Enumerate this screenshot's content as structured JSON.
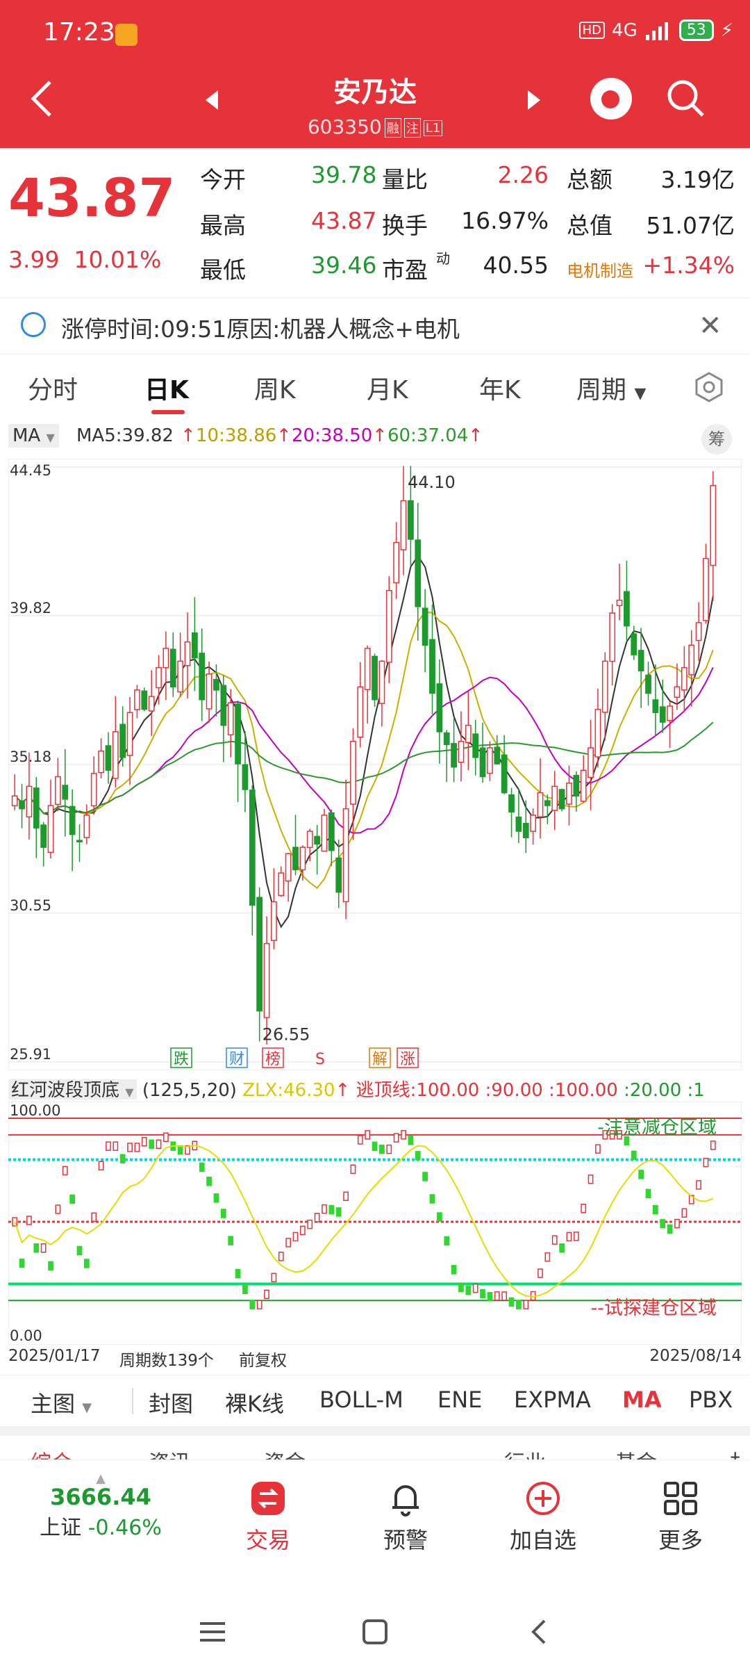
{
  "status": {
    "time": "17:23",
    "hd": "HD",
    "network": "4G",
    "battery": "53"
  },
  "header": {
    "title": "安乃达",
    "code": "603350",
    "tag1": "融",
    "tag2": "注",
    "tag3": "L1"
  },
  "quote": {
    "price": "43.87",
    "change": "3.99",
    "change_pct": "10.01%",
    "rows": [
      {
        "l1": "今开",
        "v1": "39.78",
        "l2": "量比",
        "v2": "2.26",
        "l3": "总额",
        "v3": "3.19亿"
      },
      {
        "l1": "最高",
        "v1": "43.87",
        "l2": "换手",
        "v2": "16.97%",
        "l3": "总值",
        "v3": "51.07亿"
      },
      {
        "l1": "最低",
        "v1": "39.46",
        "l2": "市盈",
        "l2sup": "动",
        "v2": "40.55",
        "l3": "电机制造",
        "v3": "+1.34%"
      }
    ]
  },
  "notice": {
    "text": "涨停时间:09:51原因:机器人概念+电机"
  },
  "tabs": [
    "分时",
    "日K",
    "周K",
    "月K",
    "年K",
    "周期"
  ],
  "ma": {
    "selector": "MA",
    "ma5": "MA5:39.82",
    "ma10": "10:38.86",
    "ma20": "20:38.50",
    "ma60": "60:37.04",
    "chip": "筹"
  },
  "chart_data": [
    {
      "type": "candlestick",
      "title": "安乃达 日K",
      "y_ticks": [
        "44.45",
        "39.82",
        "35.18",
        "30.55",
        "25.91"
      ],
      "ylim": [
        25.91,
        44.45
      ],
      "annotations": {
        "high": "44.10",
        "low": "26.55"
      },
      "event_markers": [
        "跌",
        "财",
        "榜",
        "S",
        "解",
        "涨"
      ],
      "series": [
        {
          "name": "MA5",
          "color": "#333333"
        },
        {
          "name": "MA10",
          "color": "#c9b000"
        },
        {
          "name": "MA20",
          "color": "#c000c0"
        },
        {
          "name": "MA60",
          "color": "#2a9a2a"
        }
      ],
      "closes": [
        34.2,
        33.8,
        34.5,
        33.2,
        32.6,
        33.9,
        34.8,
        34.1,
        33.0,
        32.8,
        33.6,
        34.9,
        35.6,
        35.0,
        36.2,
        35.4,
        36.8,
        37.5,
        36.9,
        37.3,
        38.2,
        38.8,
        37.6,
        38.4,
        39.0,
        38.5,
        37.2,
        38.0,
        37.5,
        36.4,
        37.1,
        35.2,
        34.4,
        30.8,
        27.5,
        29.6,
        30.9,
        31.8,
        32.4,
        31.9,
        32.6,
        33.1,
        32.7,
        33.6,
        32.5,
        31.2,
        33.8,
        35.9,
        37.6,
        38.8,
        37.2,
        38.4,
        40.6,
        42.1,
        43.4,
        42.2,
        40.1,
        38.9,
        37.4,
        36.2,
        35.8,
        35.1,
        35.9,
        36.4,
        35.4,
        34.8,
        35.7,
        35.2,
        34.3,
        33.7,
        33.1,
        32.9,
        33.6,
        34.3,
        33.9,
        34.5,
        33.8,
        34.6,
        34.2,
        35.0,
        35.7,
        36.9,
        38.4,
        39.9,
        40.3,
        39.5,
        38.6,
        38.1,
        37.4,
        36.8,
        36.5,
        37.0,
        37.6,
        38.2,
        38.9,
        39.6,
        41.6,
        43.87
      ],
      "ma5": "derived",
      "ma10": "derived",
      "ma20": "derived",
      "ma60": "derived"
    },
    {
      "type": "line",
      "title": "红河波段顶底",
      "y_ticks": [
        "100.00",
        "0.00"
      ],
      "ylim": [
        0,
        100
      ],
      "levels": [
        100,
        90,
        50,
        20
      ],
      "labels": {
        "top": "-注意减仓区域",
        "bottom": "--试探建仓区域"
      },
      "series": [
        {
          "name": "ZLX",
          "color": "#e0e000"
        }
      ]
    }
  ],
  "indicator": {
    "name": "红河波段顶底",
    "params": "(125,5,20)",
    "zlx": "ZLX:46.30",
    "escape": "逃顶线:100.00",
    "l90": ":90.00",
    "l100": ":100.00",
    "l20": ":20.00",
    "trunc": ":1"
  },
  "dates": {
    "start": "2025/01/17",
    "period": "周期数139个",
    "adjust": "前复权",
    "end": "2025/08/14"
  },
  "tools": [
    "主图",
    "封图",
    "裸K线",
    "BOLL-M",
    "ENE",
    "EXPMA",
    "MA",
    "PBX"
  ],
  "peek": [
    "综合",
    "资讯",
    "资金",
    "",
    "行业",
    "基金",
    "扌"
  ],
  "nav": {
    "index_value": "3666.44",
    "index_name": "上证",
    "index_change": "-0.46%",
    "trade": "交易",
    "alert": "预警",
    "watch": "加自选",
    "more": "更多"
  },
  "colors": {
    "brand": "#e6333a",
    "up": "#e6333a",
    "down": "#1c9a2e"
  }
}
